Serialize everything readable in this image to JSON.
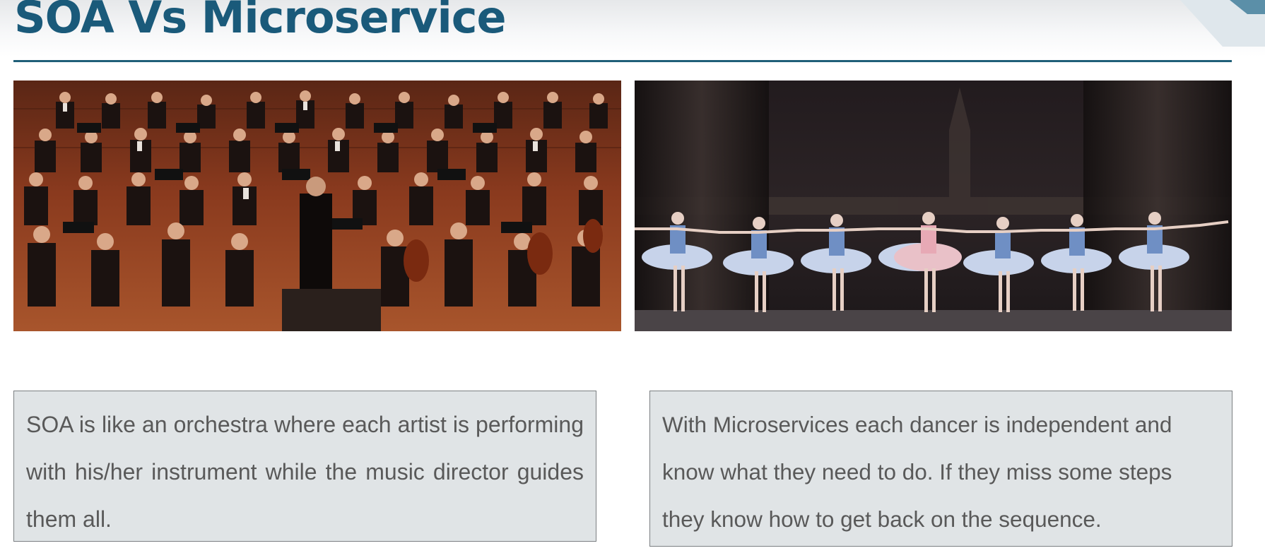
{
  "slide": {
    "title": "SOA Vs Microservice",
    "images": {
      "left": "orchestra photo",
      "right": "ballet photo"
    },
    "captions": {
      "left": "SOA is like an orchestra where each artist is performing with his/her instrument while the music director guides them all.",
      "right": "With Microservices each dancer is independent and know what they need to do. If they miss some steps they know how to get back on the sequence."
    }
  },
  "colors": {
    "title": "#1a5a7a",
    "rule": "#1f5f78",
    "caption_bg": "#e0e4e6",
    "caption_text": "#595959"
  }
}
